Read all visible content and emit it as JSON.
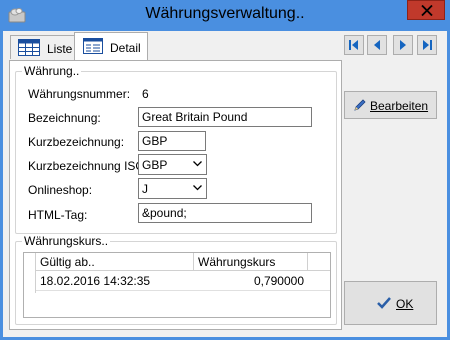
{
  "window": {
    "title": "Währungsverwaltung.."
  },
  "tabs": [
    {
      "label": "Liste",
      "icon": "table-icon",
      "active": false
    },
    {
      "label": "Detail",
      "icon": "form-icon",
      "active": true
    }
  ],
  "group_waehrung": {
    "legend": "Währung..",
    "fields": {
      "nummer_label": "Währungsnummer:",
      "nummer_value": "6",
      "bezeichnung_label": "Bezeichnung:",
      "bezeichnung_value": "Great Britain Pound",
      "kurz_label": "Kurzbezeichnung:",
      "kurz_value": "GBP",
      "iso_label": "Kurzbezeichnung ISO:",
      "iso_value": "GBP",
      "onlineshop_label": "Onlineshop:",
      "onlineshop_value": "J",
      "htmltag_label": "HTML-Tag:",
      "htmltag_value": "&pound;"
    }
  },
  "group_kurs": {
    "legend": "Währungskurs..",
    "columns": [
      "Gültig ab..",
      "Währungskurs"
    ],
    "rows": [
      [
        "18.02.2016 14:32:35",
        "0,790000"
      ]
    ]
  },
  "navigation": {
    "buttons": [
      "first-record-icon",
      "previous-record-icon",
      "next-record-icon",
      "last-record-icon"
    ]
  },
  "actions": {
    "bearbeiten_label": "Bearbeiten",
    "ok_label": "OK"
  },
  "colors": {
    "titlebar": "#4a8fe0",
    "close": "#c0392b",
    "nav_arrow": "#1565c0",
    "ok_check": "#2a5fa8"
  }
}
